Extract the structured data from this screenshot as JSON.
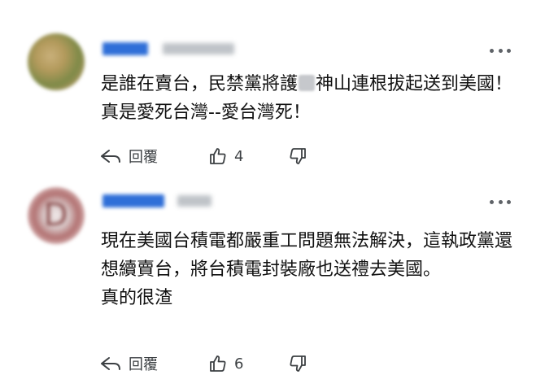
{
  "comments": [
    {
      "text_before_redaction": "是誰在賣台，民禁黨將護",
      "text_after_redaction": "神山連根拔起送到美國！真是愛死台灣--愛台灣死！",
      "reply_label": "回覆",
      "like_count": "4"
    },
    {
      "text": "現在美國台積電都嚴重工問題無法解決，這執政黨還想續賣台，將台積電封裝廠也送禮去美國。\n真的很渣",
      "avatar_letter": "D",
      "reply_label": "回覆",
      "like_count": "6"
    }
  ],
  "colors": {
    "username_blue": "#2f6fd8",
    "icon_gray": "#3c4043"
  },
  "icons": [
    "more-icon",
    "reply-icon",
    "thumbs-up-icon",
    "thumbs-down-icon"
  ]
}
